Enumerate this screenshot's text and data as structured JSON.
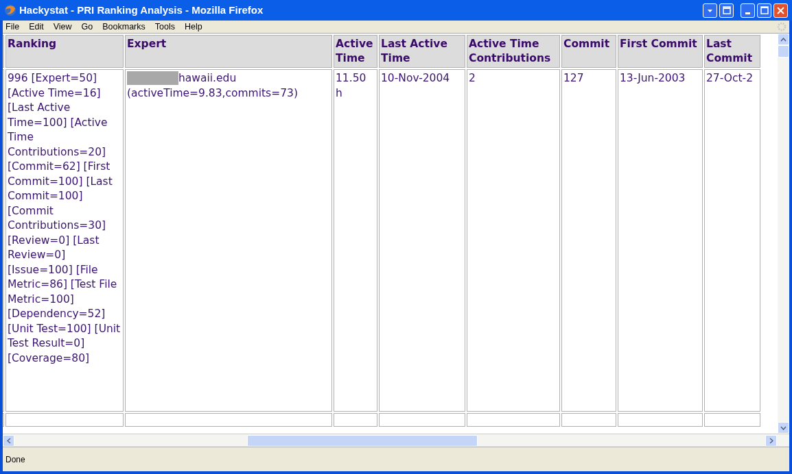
{
  "window": {
    "title": "Hackystat - PRI Ranking Analysis - Mozilla Firefox"
  },
  "menu": [
    "File",
    "Edit",
    "View",
    "Go",
    "Bookmarks",
    "Tools",
    "Help"
  ],
  "table": {
    "columns": [
      "Ranking",
      "Expert",
      "Active Time",
      "Last Active Time",
      "Active Time Contributions",
      "Commit",
      "First Commit",
      "Last Commit"
    ],
    "rows": [
      {
        "cells": [
          "996 [Expert=50] [Active Time=16] [Last Active Time=100] [Active Time Contributions=20] [Commit=62] [First Commit=100] [Last Commit=100] [Commit Contributions=30] [Review=0] [Last Review=0] [Issue=100] [File Metric=86] [Test File Metric=100] [Dependency=52] [Unit Test=100] [Unit Test Result=0] [Coverage=80]",
          "hawaii.edu (activeTime=9.83,commits=73)",
          "11.50 h",
          "10-Nov-2004",
          "2",
          "127",
          "13-Jun-2003",
          "27-Oct-2"
        ],
        "redacted": true
      }
    ]
  },
  "status_bar": "Done"
}
